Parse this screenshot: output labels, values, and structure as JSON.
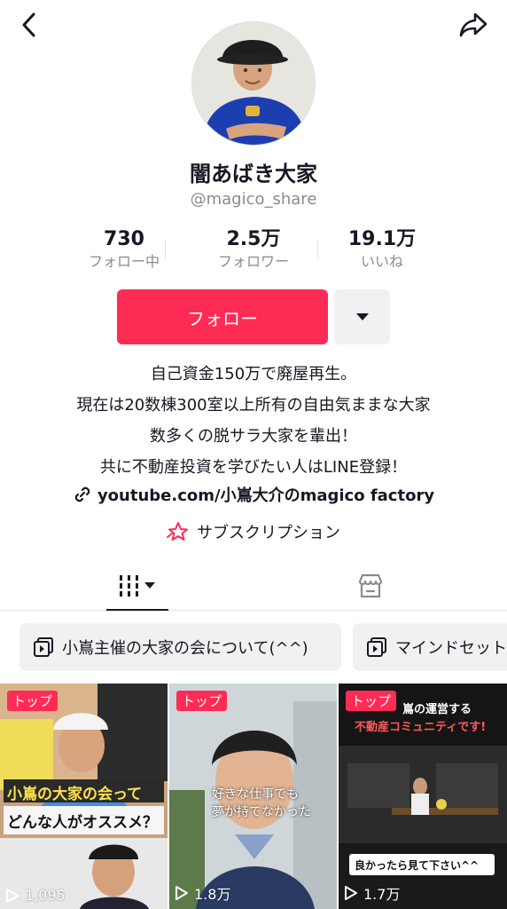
{
  "profile": {
    "display_name": "闇あばき大家",
    "handle": "@magico_share"
  },
  "stats": [
    {
      "value": "730",
      "label": "フォロー中"
    },
    {
      "value": "2.5万",
      "label": "フォロワー"
    },
    {
      "value": "19.1万",
      "label": "いいね"
    }
  ],
  "actions": {
    "follow_label": "フォロー"
  },
  "bio": {
    "lines": [
      "自己資金150万で廃屋再生。",
      "現在は20数棟300室以上所有の自由気ままな大家",
      "数多くの脱サラ大家を輩出！",
      "共に不動産投資を学びたい人はLINE登録！"
    ],
    "link": "youtube.com/小嶌大介のmagico factory",
    "subscription": "サブスクリプション"
  },
  "playlists": [
    {
      "label": "小嶌主催の大家の会について(^^)"
    },
    {
      "label": "マインドセット"
    }
  ],
  "videos": [
    {
      "tag": "トップ",
      "caption1": "小嶌の大家の会って",
      "caption2": "どんな人がオススメ？",
      "views": "1,095"
    },
    {
      "tag": "トップ",
      "caption1": "好きな仕事でも",
      "caption2": "夢が持てなかった",
      "views": "1.8万"
    },
    {
      "tag": "トップ",
      "caption1": "嶌の運営する",
      "caption2": "不動産コミュニティです!",
      "caption3": "良かったら見て下さい^^",
      "views": "1.7万"
    }
  ],
  "colors": {
    "accent": "#fe2c55",
    "text": "#161823",
    "secondary": "#8a8b91"
  }
}
